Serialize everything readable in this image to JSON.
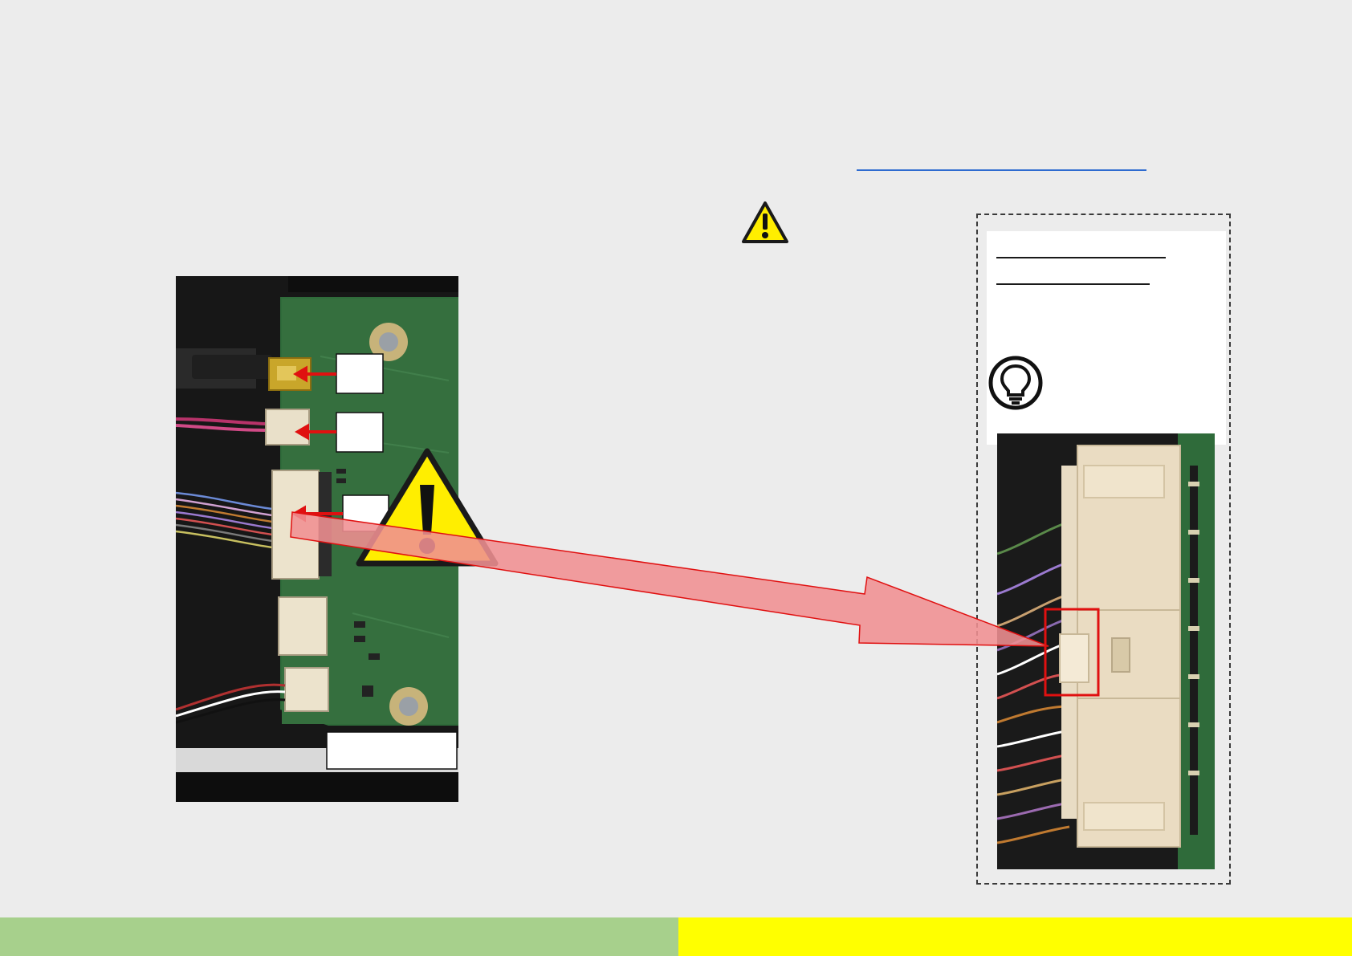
{
  "colors": {
    "background": "#ececec",
    "link": "#2e6bd0",
    "warning_yellow": "#ffee00",
    "arrow_fill": "#f08f92",
    "arrow_stroke": "#e01010",
    "highlight_box": "#e01010",
    "footer_left": "#a7d08c",
    "footer_right": "#ffff00"
  },
  "icons": {
    "warning": "warning-triangle-icon",
    "tip": "lightbulb-icon"
  }
}
